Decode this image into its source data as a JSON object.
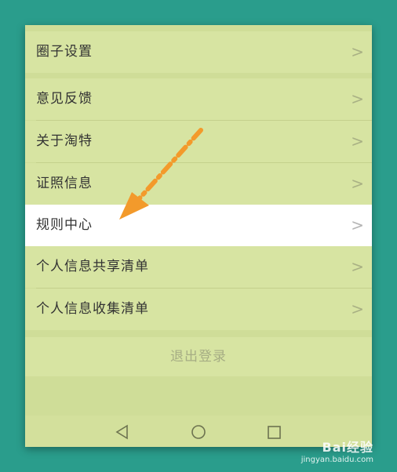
{
  "menu": {
    "items": [
      {
        "label": "圈子设置",
        "chevron": "chevron-right-icon"
      },
      {
        "label": "意见反馈",
        "chevron": "chevron-right-icon"
      },
      {
        "label": "关于淘特",
        "chevron": "chevron-right-icon"
      },
      {
        "label": "证照信息",
        "chevron": "chevron-right-icon"
      },
      {
        "label": "规则中心",
        "chevron": "chevron-right-icon"
      },
      {
        "label": "个人信息共享清单",
        "chevron": "chevron-right-icon"
      },
      {
        "label": "个人信息收集清单",
        "chevron": "chevron-right-icon"
      }
    ],
    "logout_label": "退出登录"
  },
  "chevron_glyph": ">",
  "navbar": {
    "back_icon": "back-triangle-icon",
    "home_icon": "home-circle-icon",
    "recents_icon": "recents-square-icon"
  },
  "annotation": {
    "arrow_icon": "orange-dashed-arrow-icon",
    "color": "#f39a2b"
  },
  "watermark": {
    "brand": "Bai经验",
    "url": "jingyan.baidu.com"
  },
  "colors": {
    "background": "#2a9d8c",
    "panel": "#cfdd98",
    "row": "#d7e4a2",
    "highlight_row": "#ffffff",
    "text": "#333333",
    "muted_text": "#a6ad84"
  }
}
